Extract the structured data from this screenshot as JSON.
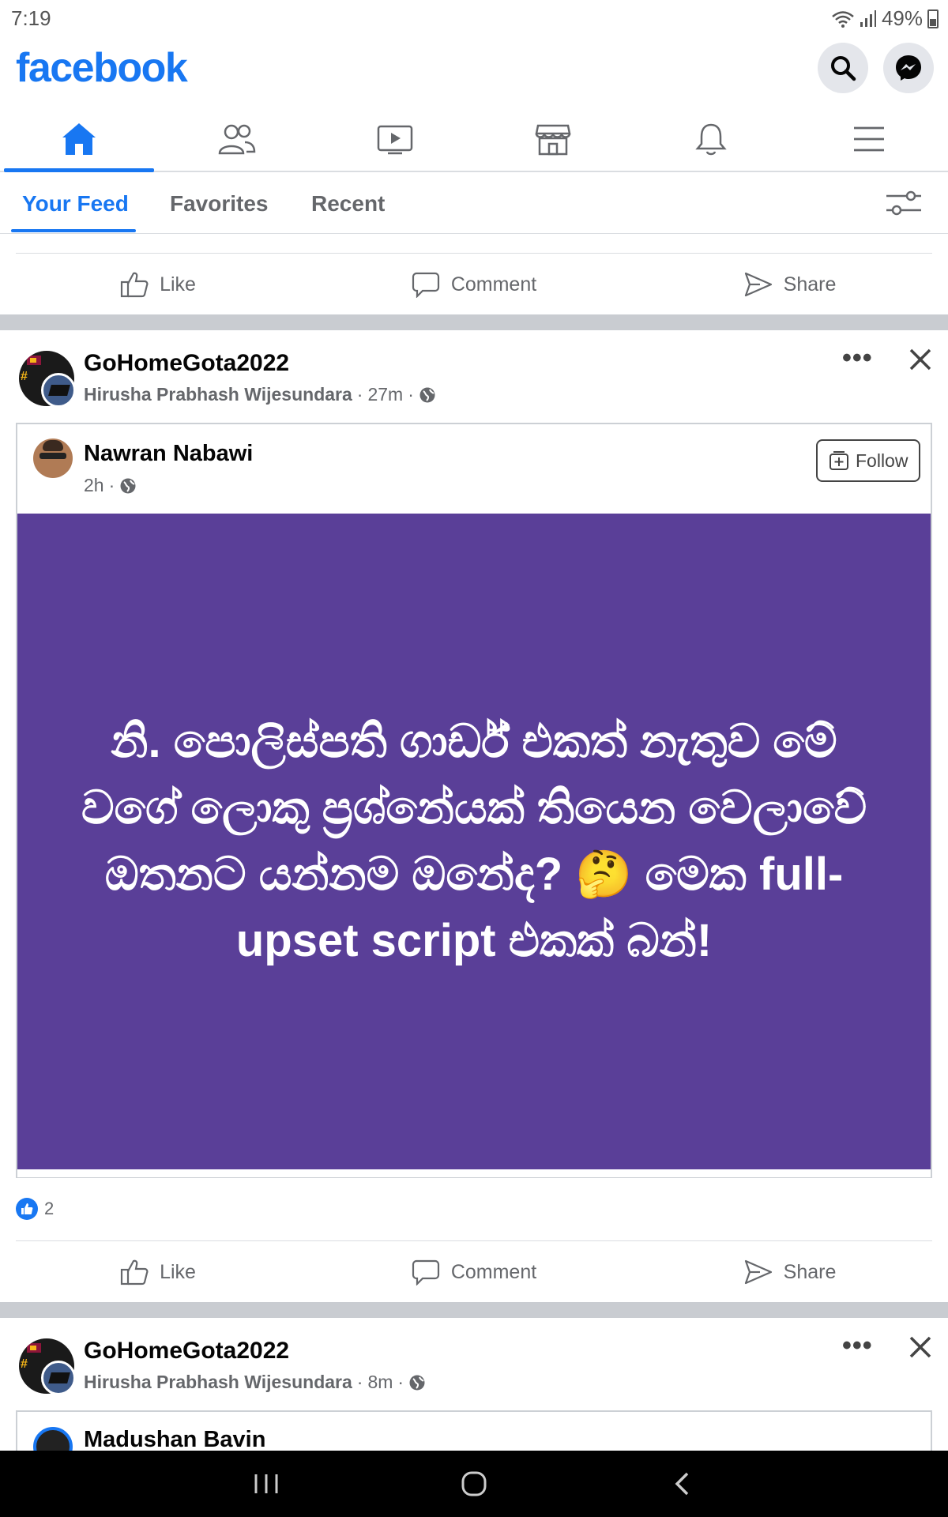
{
  "status": {
    "time": "7:19",
    "battery": "49%"
  },
  "header": {
    "logo": "facebook"
  },
  "feed_tabs": [
    {
      "label": "Your Feed"
    },
    {
      "label": "Favorites"
    },
    {
      "label": "Recent"
    }
  ],
  "actions": {
    "like": "Like",
    "comment": "Comment",
    "share": "Share"
  },
  "post1": {
    "group": "GoHomeGota2022",
    "author": "Hirusha Prabhash Wijesundara",
    "time": "27m",
    "shared": {
      "name": "Nawran Nabawi",
      "time": "2h",
      "follow": "Follow",
      "text": "නි. පොලිස්පති ගාර්ඩ් එකත් නැතුව මේ වගේ ලොකු ප්‍රශ්නේයක් තියෙන වෙලාවේ ඔතනට යන්නම ඔනේද? 🤔 මෙක full-upset script එකක් බන්!"
    },
    "likes": "2"
  },
  "post2": {
    "group": "GoHomeGota2022",
    "author": "Hirusha Prabhash Wijesundara",
    "time": "8m",
    "shared": {
      "name": "Madushan Bavin"
    }
  },
  "colors": {
    "brand": "#1877f2",
    "post_bg": "#5a3f98",
    "separator": "#c9ccd1"
  }
}
